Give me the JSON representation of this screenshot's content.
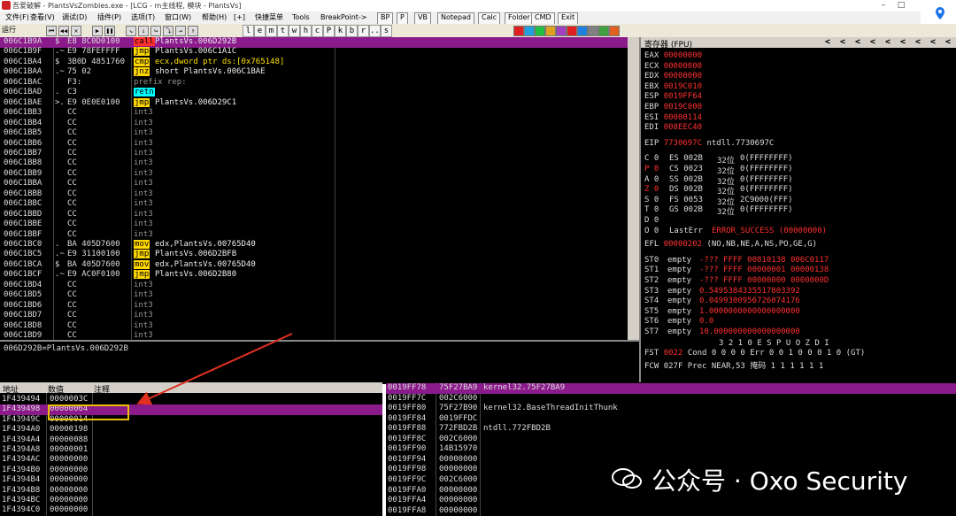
{
  "titlebar": {
    "title": "吾爱破解 - PlantsVsZombies.exe - [LCG - m主线程, 模块 - PlantsVs]"
  },
  "menu": {
    "items": [
      "文件(F)",
      "查看(V)",
      "调试(D)",
      "插件(P)",
      "选项(T)",
      "窗口(W)",
      "帮助(H)",
      "[+]",
      "快捷菜单",
      "Tools",
      "BreakPoint->"
    ],
    "buttons": [
      "BP",
      "P",
      "VB",
      "Notepad",
      "Calc",
      "Folder",
      "CMD",
      "Exit"
    ]
  },
  "toolbar": {
    "run_label": "运行",
    "letters": [
      "l",
      "e",
      "m",
      "t",
      "w",
      "h",
      "c",
      "P",
      "k",
      "b",
      "r",
      "...",
      "s"
    ]
  },
  "cpu": {
    "rows": [
      {
        "addr": "006C1B9A",
        "mark": "$",
        "hex": "E8 8C0D0100",
        "mn": "call",
        "ops": "PlantsVs.006D292B",
        "style": "r",
        "sel": true
      },
      {
        "addr": "006C1B9F",
        "mark": ".~",
        "hex": "E9 78FEFFFF",
        "mn": "jmp",
        "ops": "PlantsVs.006C1A1C",
        "style": "y"
      },
      {
        "addr": "006C1BA4",
        "mark": "$",
        "hex": "3B0D 4851760",
        "mn": "cmp",
        "ops": "ecx,dword ptr ds:[0x765148]",
        "style": "y",
        "opsyellow": true
      },
      {
        "addr": "006C1BAA",
        "mark": ".~",
        "hex": "75 02",
        "mn": "jnz",
        "ops": "short PlantsVs.006C1BAE",
        "style": "y"
      },
      {
        "addr": "006C1BAC",
        "mark": "",
        "hex": "F3:",
        "mn": "prefix rep:",
        "ops": "",
        "style": "dim"
      },
      {
        "addr": "006C1BAD",
        "mark": ".",
        "hex": "C3",
        "mn": "retn",
        "ops": "",
        "style": "c"
      },
      {
        "addr": "006C1BAE",
        "mark": ">.",
        "hex": "E9 0E0E0100",
        "mn": "jmp",
        "ops": "PlantsVs.006D29C1",
        "style": "y"
      },
      {
        "addr": "006C1BB3",
        "mark": "",
        "hex": "CC",
        "mn": "int3",
        "ops": "",
        "style": "dim"
      },
      {
        "addr": "006C1BB4",
        "mark": "",
        "hex": "CC",
        "mn": "int3",
        "ops": "",
        "style": "dim"
      },
      {
        "addr": "006C1BB5",
        "mark": "",
        "hex": "CC",
        "mn": "int3",
        "ops": "",
        "style": "dim"
      },
      {
        "addr": "006C1BB6",
        "mark": "",
        "hex": "CC",
        "mn": "int3",
        "ops": "",
        "style": "dim"
      },
      {
        "addr": "006C1BB7",
        "mark": "",
        "hex": "CC",
        "mn": "int3",
        "ops": "",
        "style": "dim"
      },
      {
        "addr": "006C1BB8",
        "mark": "",
        "hex": "CC",
        "mn": "int3",
        "ops": "",
        "style": "dim"
      },
      {
        "addr": "006C1BB9",
        "mark": "",
        "hex": "CC",
        "mn": "int3",
        "ops": "",
        "style": "dim"
      },
      {
        "addr": "006C1BBA",
        "mark": "",
        "hex": "CC",
        "mn": "int3",
        "ops": "",
        "style": "dim"
      },
      {
        "addr": "006C1BBB",
        "mark": "",
        "hex": "CC",
        "mn": "int3",
        "ops": "",
        "style": "dim"
      },
      {
        "addr": "006C1BBC",
        "mark": "",
        "hex": "CC",
        "mn": "int3",
        "ops": "",
        "style": "dim"
      },
      {
        "addr": "006C1BBD",
        "mark": "",
        "hex": "CC",
        "mn": "int3",
        "ops": "",
        "style": "dim"
      },
      {
        "addr": "006C1BBE",
        "mark": "",
        "hex": "CC",
        "mn": "int3",
        "ops": "",
        "style": "dim"
      },
      {
        "addr": "006C1BBF",
        "mark": "",
        "hex": "CC",
        "mn": "int3",
        "ops": "",
        "style": "dim"
      },
      {
        "addr": "006C1BC0",
        "mark": ".",
        "hex": "BA 405D7600",
        "mn": "mov",
        "ops": "edx,PlantsVs.00765D40",
        "style": "y"
      },
      {
        "addr": "006C1BC5",
        "mark": ".~",
        "hex": "E9 31100100",
        "mn": "jmp",
        "ops": "PlantsVs.006D2BFB",
        "style": "y"
      },
      {
        "addr": "006C1BCA",
        "mark": "$",
        "hex": "BA 405D7600",
        "mn": "mov",
        "ops": "edx,PlantsVs.00765D40",
        "style": "y"
      },
      {
        "addr": "006C1BCF",
        "mark": ".~",
        "hex": "E9 AC0F0100",
        "mn": "jmp",
        "ops": "PlantsVs.006D2B80",
        "style": "y"
      },
      {
        "addr": "006C1BD4",
        "mark": "",
        "hex": "CC",
        "mn": "int3",
        "ops": "",
        "style": "dim"
      },
      {
        "addr": "006C1BD5",
        "mark": "",
        "hex": "CC",
        "mn": "int3",
        "ops": "",
        "style": "dim"
      },
      {
        "addr": "006C1BD6",
        "mark": "",
        "hex": "CC",
        "mn": "int3",
        "ops": "",
        "style": "dim"
      },
      {
        "addr": "006C1BD7",
        "mark": "",
        "hex": "CC",
        "mn": "int3",
        "ops": "",
        "style": "dim"
      },
      {
        "addr": "006C1BD8",
        "mark": "",
        "hex": "CC",
        "mn": "int3",
        "ops": "",
        "style": "dim"
      },
      {
        "addr": "006C1BD9",
        "mark": "",
        "hex": "CC",
        "mn": "int3",
        "ops": "",
        "style": "dim"
      }
    ]
  },
  "info": {
    "text": "006D292B=PlantsVs.006D292B"
  },
  "registers": {
    "header": "寄存器 (FPU)",
    "header_arrows": [
      "<",
      "<",
      "<",
      "<",
      "<",
      "<",
      "<",
      "<",
      "<"
    ],
    "gp": [
      {
        "name": "EAX",
        "val": "00000000"
      },
      {
        "name": "ECX",
        "val": "00000000"
      },
      {
        "name": "EDX",
        "val": "00000000"
      },
      {
        "name": "EBX",
        "val": "0019C010"
      },
      {
        "name": "ESP",
        "val": "0019FF64"
      },
      {
        "name": "EBP",
        "val": "0019C000"
      },
      {
        "name": "ESI",
        "val": "00000114"
      },
      {
        "name": "EDI",
        "val": "008EEC40"
      }
    ],
    "eip": {
      "name": "EIP",
      "val": "7730697C",
      "desc": "ntdll.7730697C"
    },
    "flags": [
      {
        "f": "C 0",
        "seg": "ES 002B",
        "bits": "32位",
        "rng": "0(FFFFFFFF)"
      },
      {
        "f": "P 0",
        "seg": "CS 0023",
        "bits": "32位",
        "rng": "0(FFFFFFFF)"
      },
      {
        "f": "A 0",
        "seg": "SS 002B",
        "bits": "32位",
        "rng": "0(FFFFFFFF)"
      },
      {
        "f": "Z 0",
        "seg": "DS 002B",
        "bits": "32位",
        "rng": "0(FFFFFFFF)"
      },
      {
        "f": "S 0",
        "seg": "FS 0053",
        "bits": "32位",
        "rng": "2C9000(FFF)"
      },
      {
        "f": "T 0",
        "seg": "GS 002B",
        "bits": "32位",
        "rng": "0(FFFFFFFF)"
      },
      {
        "f": "D 0",
        "seg": "",
        "bits": "",
        "rng": ""
      },
      {
        "f": "O 0",
        "seg": "LastErr",
        "bits": "",
        "rng": "ERROR_SUCCESS (00000000)"
      }
    ],
    "efl": {
      "name": "EFL",
      "val": "00000202",
      "desc": "(NO,NB,NE,A,NS,PO,GE,G)"
    },
    "fpu": [
      {
        "name": "ST0",
        "state": "empty",
        "val": "-??? FFFF 00810138 006C0117"
      },
      {
        "name": "ST1",
        "state": "empty",
        "val": "-??? FFFF 00000001 00000138"
      },
      {
        "name": "ST2",
        "state": "empty",
        "val": "-??? FFFF 00000000 0000000D"
      },
      {
        "name": "ST3",
        "state": "empty",
        "val": "0.5495384335517803392"
      },
      {
        "name": "ST4",
        "state": "empty",
        "val": "0.0499300956726074176"
      },
      {
        "name": "ST5",
        "state": "empty",
        "val": "1.0000000000000000000"
      },
      {
        "name": "ST6",
        "state": "empty",
        "val": "0.0"
      },
      {
        "name": "ST7",
        "state": "empty",
        "val": "10.000000000000000000"
      }
    ],
    "fst_header": "3 2 1 0      E S P U O Z D I",
    "fst": {
      "label": "FST",
      "val": "0022",
      "rest": "Cond 0 0 0 0  Err 0 0 1 0 0 0 1 0  (GT)"
    },
    "fcw": {
      "label": "FCW",
      "val": "027F",
      "rest": "Prec NEAR,53  掩码    1 1 1 1 1 1"
    }
  },
  "dump": {
    "headers": [
      "地址",
      "数值",
      "注释"
    ],
    "rows": [
      {
        "addr": "1F439494",
        "val": "0000003C",
        "sel": false
      },
      {
        "addr": "1F439498",
        "val": "00000064",
        "sel": true
      },
      {
        "addr": "1F43949C",
        "val": "00000014",
        "sel": false
      },
      {
        "addr": "1F4394A0",
        "val": "00000198",
        "sel": false
      },
      {
        "addr": "1F4394A4",
        "val": "00000088",
        "sel": false
      },
      {
        "addr": "1F4394A8",
        "val": "00000001",
        "sel": false
      },
      {
        "addr": "1F4394AC",
        "val": "00000000",
        "sel": false
      },
      {
        "addr": "1F4394B0",
        "val": "00000000",
        "sel": false
      },
      {
        "addr": "1F4394B4",
        "val": "00000000",
        "sel": false
      },
      {
        "addr": "1F4394B8",
        "val": "00000000",
        "sel": false
      },
      {
        "addr": "1F4394BC",
        "val": "00000000",
        "sel": false
      },
      {
        "addr": "1F4394C0",
        "val": "00000000",
        "sel": false
      }
    ]
  },
  "stack": {
    "rows": [
      {
        "addr": "0019FF78",
        "val": "75F27BA9",
        "cmt": "kernel32.75F27BA9",
        "sel": true
      },
      {
        "addr": "0019FF7C",
        "val": "002C6000",
        "cmt": "",
        "sel": false
      },
      {
        "addr": "0019FF80",
        "val": "75F27B90",
        "cmt": "kernel32.BaseThreadInitThunk",
        "sel": false
      },
      {
        "addr": "0019FF84",
        "val": "0019FFDC",
        "cmt": "",
        "sel": false
      },
      {
        "addr": "0019FF88",
        "val": "772FBD2B",
        "cmt": "ntdll.772FBD2B",
        "sel": false
      },
      {
        "addr": "0019FF8C",
        "val": "002C6000",
        "cmt": "",
        "sel": false
      },
      {
        "addr": "0019FF90",
        "val": "14B15970",
        "cmt": "",
        "sel": false
      },
      {
        "addr": "0019FF94",
        "val": "00000000",
        "cmt": "",
        "sel": false
      },
      {
        "addr": "0019FF98",
        "val": "00000000",
        "cmt": "",
        "sel": false
      },
      {
        "addr": "0019FF9C",
        "val": "002C6000",
        "cmt": "",
        "sel": false
      },
      {
        "addr": "0019FFA0",
        "val": "00000000",
        "cmt": "",
        "sel": false
      },
      {
        "addr": "0019FFA4",
        "val": "00000000",
        "cmt": "",
        "sel": false
      },
      {
        "addr": "0019FFA8",
        "val": "00000000",
        "cmt": "",
        "sel": false
      }
    ]
  },
  "watermark": {
    "text": "公众号 · Oxo Security"
  },
  "colors": {
    "selection": "#8b1a8b",
    "reg_value": "#ff3030",
    "highlight_box": "#e8c000",
    "arrow": "#e03020"
  }
}
